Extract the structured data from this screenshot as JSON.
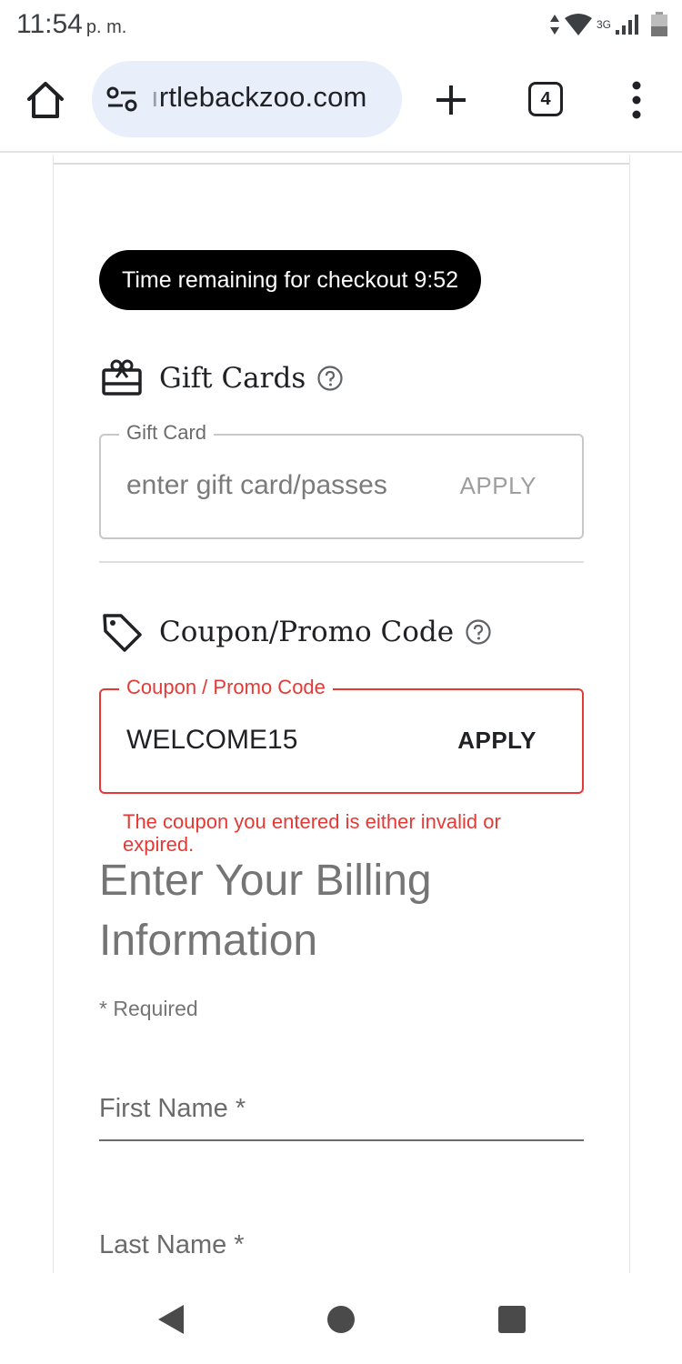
{
  "status_bar": {
    "time": "11:54",
    "ampm": "p. m.",
    "network": "3G"
  },
  "browser": {
    "url_prefix": "ı",
    "url": "rtlebackzoo.com",
    "tab_count": "4",
    "icons": [
      "home-icon",
      "site-info-icon",
      "plus-icon",
      "tabs-icon",
      "more-vert-icon"
    ]
  },
  "checkout": {
    "timer_text": "Time remaining for checkout 9:52"
  },
  "gift_cards": {
    "title": "Gift Cards",
    "field_label": "Gift Card",
    "placeholder": "enter gift card/passes",
    "apply_label": "APPLY"
  },
  "coupon": {
    "title": "Coupon/Promo Code",
    "field_label": "Coupon / Promo Code",
    "value": "WELCOME15",
    "apply_label": "APPLY",
    "error": "The coupon you entered is either invalid or expired.",
    "error_color": "#e53935"
  },
  "billing": {
    "title": "Enter Your Billing Information",
    "required_note": "* Required",
    "first_name_label": "First Name *",
    "last_name_label": "Last Name *"
  },
  "nav_bar": {
    "icons": [
      "back-icon",
      "home-circle-icon",
      "recents-icon"
    ]
  }
}
